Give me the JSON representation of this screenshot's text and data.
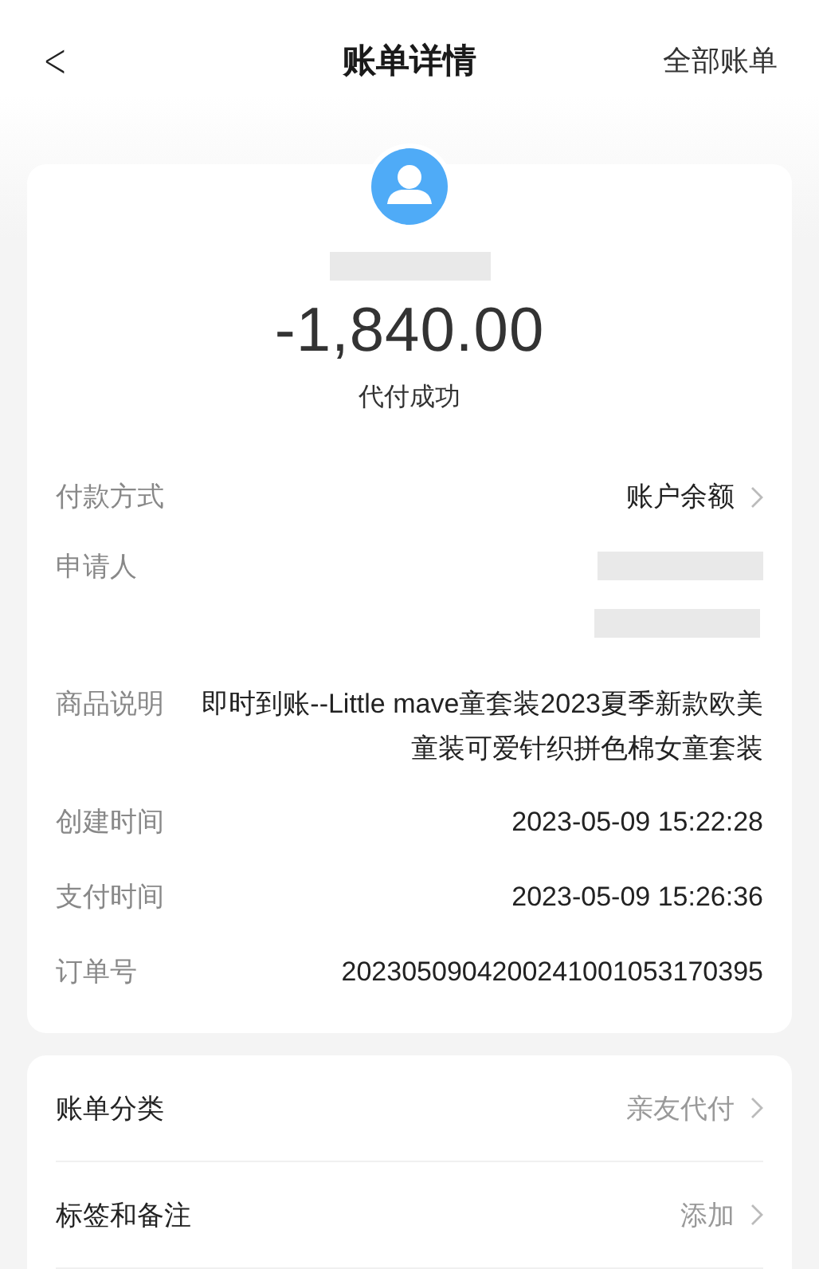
{
  "header": {
    "back": "<",
    "title": "账单详情",
    "action": "全部账单"
  },
  "summary": {
    "amount": "-1,840.00",
    "status": "代付成功"
  },
  "details": [
    {
      "kind": "link",
      "label": "付款方式",
      "value": "账户余额"
    },
    {
      "kind": "redacted",
      "label": "申请人"
    },
    {
      "kind": "text",
      "label": "商品说明",
      "value": "即时到账--Little mave童套装2023夏季新款欧美童装可爱针织拼色棉女童套装"
    },
    {
      "kind": "text",
      "label": "创建时间",
      "value": "2023-05-09 15:22:28"
    },
    {
      "kind": "text",
      "label": "支付时间",
      "value": "2023-05-09 15:26:36"
    },
    {
      "kind": "text",
      "label": "订单号",
      "value": "2023050904200241001053170395"
    }
  ],
  "options": [
    {
      "label": "账单分类",
      "value": "亲友代付"
    },
    {
      "label": "标签和备注",
      "value": "添加"
    }
  ]
}
